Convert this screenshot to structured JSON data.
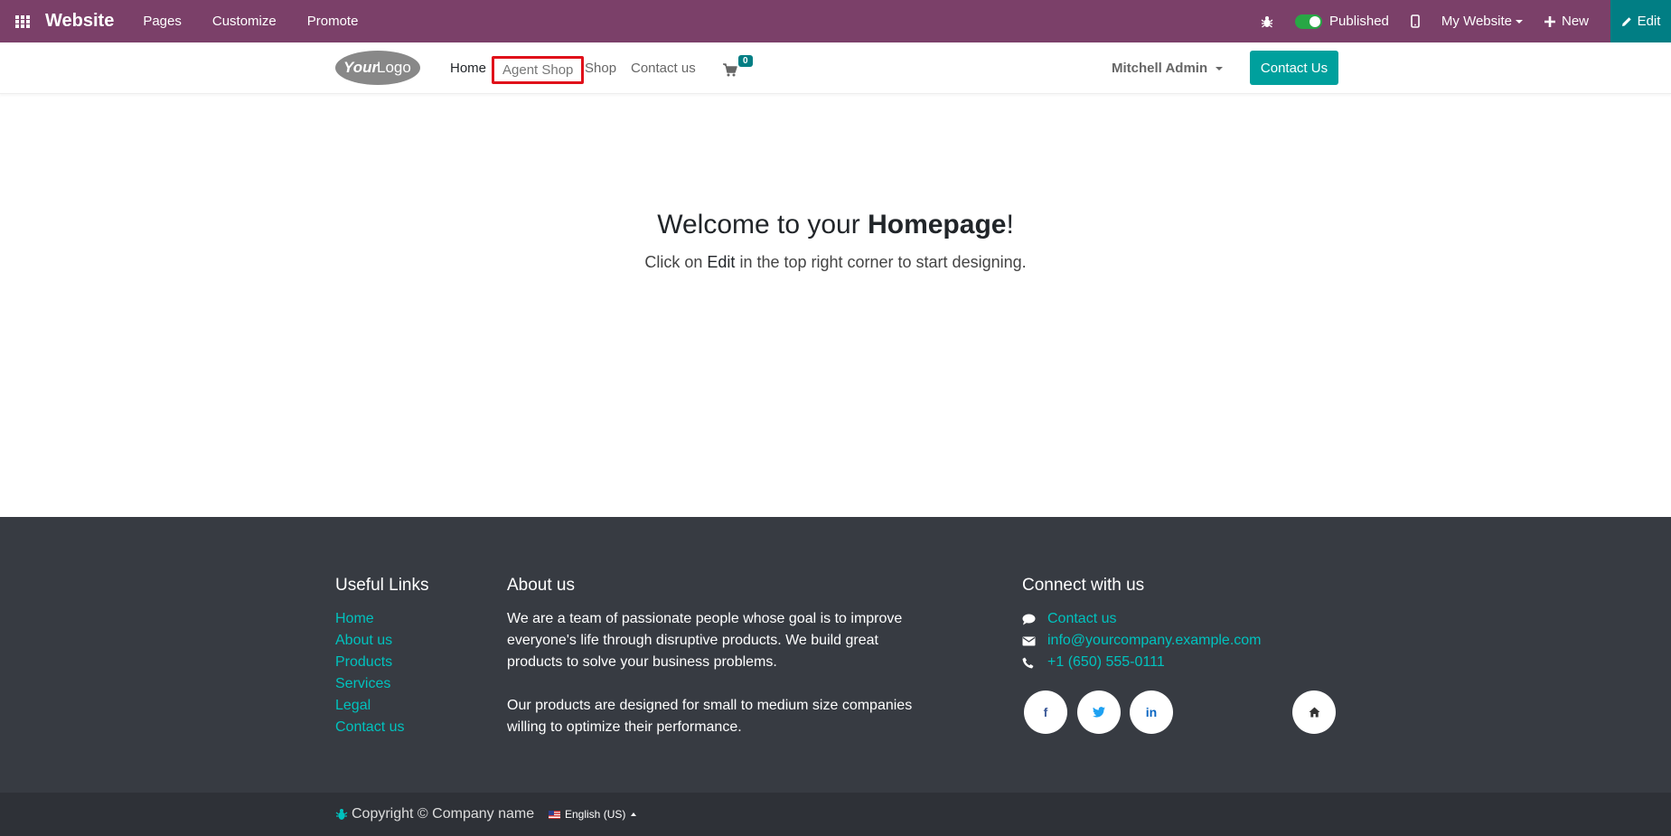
{
  "adminbar": {
    "brand": "Website",
    "menu": [
      "Pages",
      "Customize",
      "Promote"
    ],
    "published_label": "Published",
    "website_label": "My Website",
    "new_label": "New",
    "edit_label": "Edit"
  },
  "header": {
    "logo_text_1": "Your",
    "logo_text_2": "Logo",
    "nav": [
      "Home",
      "Agent Shop",
      "Shop",
      "Contact us"
    ],
    "cart_count": "0",
    "user": "Mitchell Admin",
    "cta": "Contact Us"
  },
  "main": {
    "title_pre": "Welcome to your ",
    "title_bold": "Homepage",
    "title_post": "!",
    "sub_pre": "Click on ",
    "sub_edit": "Edit",
    "sub_post": " in the top right corner to start designing."
  },
  "footer": {
    "useful_links_title": "Useful Links",
    "useful_links": [
      "Home",
      "About us",
      "Products",
      "Services",
      "Legal",
      "Contact us"
    ],
    "about_title": "About us",
    "about_p1": "We are a team of passionate people whose goal is to improve everyone's life through disruptive products. We build great products to solve your business problems.",
    "about_p2": "Our products are designed for small to medium size companies willing to optimize their performance.",
    "connect_title": "Connect with us",
    "connect": {
      "contact": "Contact us",
      "email": "info@yourcompany.example.com",
      "phone": "+1 (650) 555-0111"
    },
    "socials": {
      "facebook": "f",
      "linkedin": "in"
    },
    "copyright": "Copyright © Company name",
    "language": "English (US)"
  },
  "colors": {
    "adminbar": "#7b4069",
    "accent": "#00a09d",
    "footer": "#373b42",
    "highlight": "#e0101a"
  }
}
